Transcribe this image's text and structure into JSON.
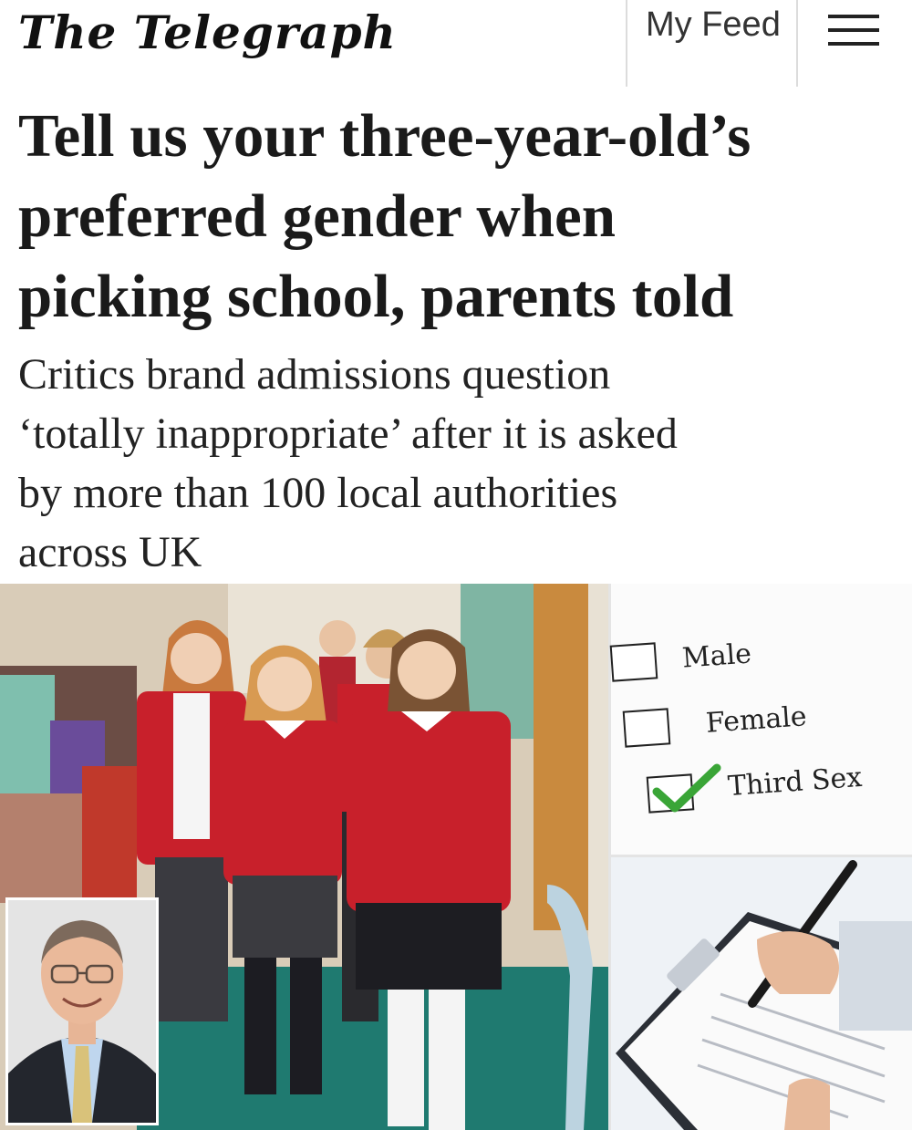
{
  "header": {
    "logo_text": "The Telegraph",
    "my_feed_label": "My Feed",
    "menu_icon": "hamburger-menu-icon"
  },
  "article": {
    "headline_lines": [
      "Tell us your three-year-old’s",
      "preferred gender when",
      "picking school, parents told"
    ],
    "subheadline_lines": [
      "Critics brand admissions question",
      "‘totally inappropriate’ after it is asked",
      "by more than 100 local authorities",
      "across UK"
    ]
  },
  "images": {
    "form_options": [
      "Male",
      "Female",
      "Third Sex"
    ],
    "checked_option": "Third Sex",
    "check_color": "#3aa537",
    "uniform_color": "#c8202b"
  }
}
